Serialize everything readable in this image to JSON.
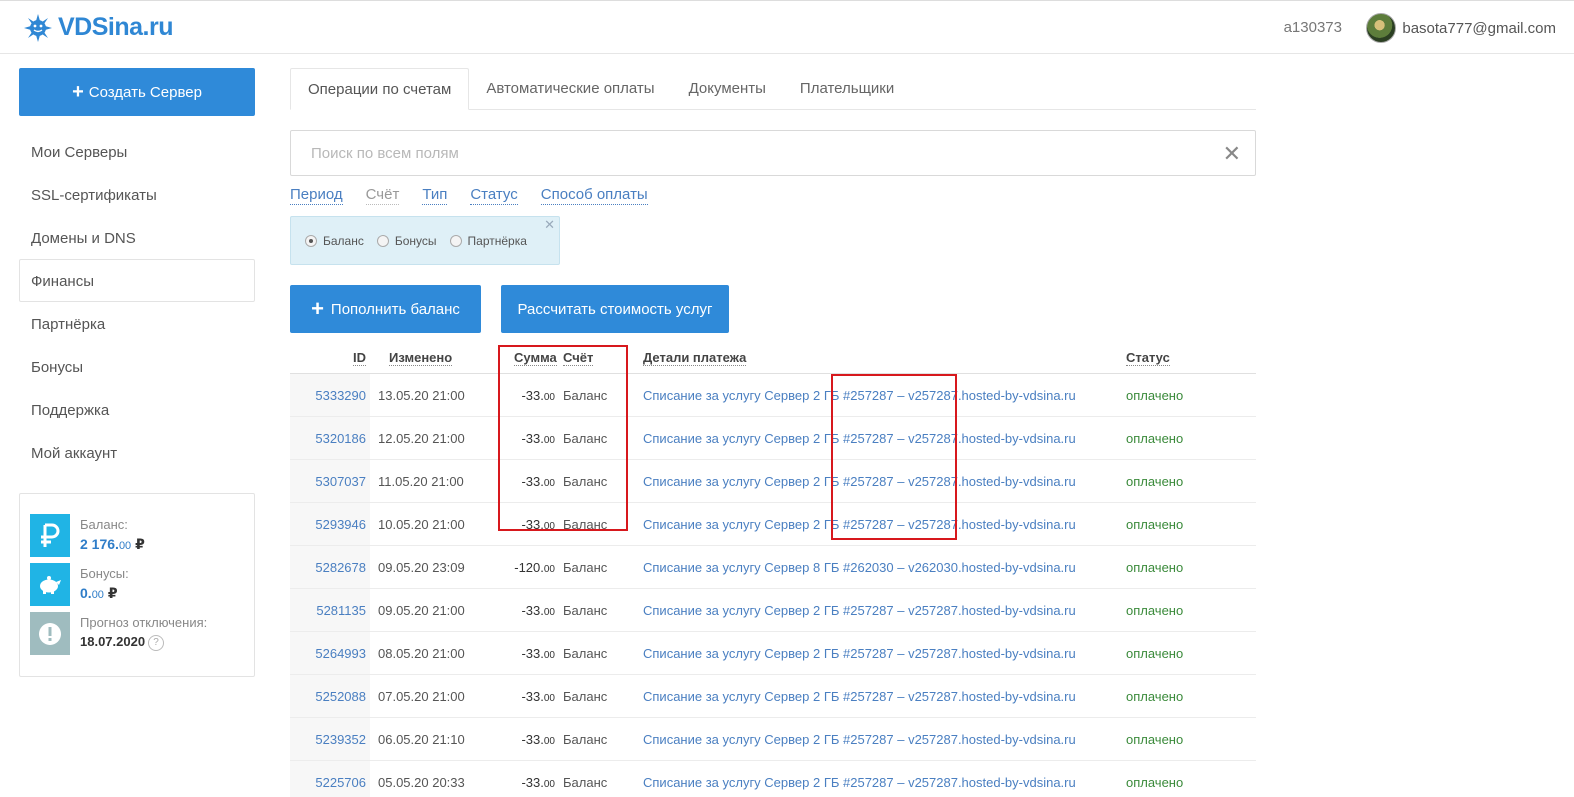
{
  "header": {
    "logo_text": "VDSina.ru",
    "account_id": "a130373",
    "user_email": "basota777@gmail.com"
  },
  "sidebar": {
    "create_button": "Создать Сервер",
    "items": [
      {
        "label": "Мои Серверы"
      },
      {
        "label": "SSL-сертификаты"
      },
      {
        "label": "Домены и DNS"
      },
      {
        "label": "Финансы"
      },
      {
        "label": "Партнёрка"
      },
      {
        "label": "Бонусы"
      },
      {
        "label": "Поддержка"
      },
      {
        "label": "Мой аккаунт"
      }
    ],
    "balance": {
      "balance_label": "Баланс:",
      "balance_int": "2 176.",
      "balance_frac": "00",
      "currency": "₽",
      "bonus_label": "Бонусы:",
      "bonus_int": "0.",
      "bonus_frac": "00",
      "forecast_label": "Прогноз отключения:",
      "forecast_date": "18.07.2020",
      "help": "?"
    }
  },
  "tabs": [
    {
      "label": "Операции по счетам",
      "active": true
    },
    {
      "label": "Автоматические оплаты"
    },
    {
      "label": "Документы"
    },
    {
      "label": "Плательщики"
    }
  ],
  "search": {
    "placeholder": "Поиск по всем полям",
    "value": ""
  },
  "filters": [
    {
      "label": "Период"
    },
    {
      "label": "Счёт"
    },
    {
      "label": "Тип"
    },
    {
      "label": "Статус"
    },
    {
      "label": "Способ оплаты"
    }
  ],
  "account_filter": {
    "options": [
      {
        "label": "Баланс",
        "checked": true
      },
      {
        "label": "Бонусы",
        "checked": false
      },
      {
        "label": "Партнёрка",
        "checked": false
      }
    ]
  },
  "actions": {
    "topup": "Пополнить баланс",
    "calc": "Рассчитать стоимость услуг"
  },
  "table": {
    "columns": {
      "id": "ID",
      "changed": "Изменено",
      "amount": "Сумма",
      "account": "Счёт",
      "details": "Детали платежа",
      "status": "Статус"
    },
    "rows": [
      {
        "id": "5333290",
        "changed": "13.05.20 21:00",
        "amount_int": "-33.",
        "amount_frac": "00",
        "account": "Баланс",
        "details": "Списание за услугу Сервер 2 ГБ #257287 – v257287.hosted-by-vdsina.ru",
        "status": "оплачено"
      },
      {
        "id": "5320186",
        "changed": "12.05.20 21:00",
        "amount_int": "-33.",
        "amount_frac": "00",
        "account": "Баланс",
        "details": "Списание за услугу Сервер 2 ГБ #257287 – v257287.hosted-by-vdsina.ru",
        "status": "оплачено"
      },
      {
        "id": "5307037",
        "changed": "11.05.20 21:00",
        "amount_int": "-33.",
        "amount_frac": "00",
        "account": "Баланс",
        "details": "Списание за услугу Сервер 2 ГБ #257287 – v257287.hosted-by-vdsina.ru",
        "status": "оплачено"
      },
      {
        "id": "5293946",
        "changed": "10.05.20 21:00",
        "amount_int": "-33.",
        "amount_frac": "00",
        "account": "Баланс",
        "details": "Списание за услугу Сервер 2 ГБ #257287 – v257287.hosted-by-vdsina.ru",
        "status": "оплачено"
      },
      {
        "id": "5282678",
        "changed": "09.05.20 23:09",
        "amount_int": "-120.",
        "amount_frac": "00",
        "account": "Баланс",
        "details": "Списание за услугу Сервер 8 ГБ #262030 – v262030.hosted-by-vdsina.ru",
        "status": "оплачено"
      },
      {
        "id": "5281135",
        "changed": "09.05.20 21:00",
        "amount_int": "-33.",
        "amount_frac": "00",
        "account": "Баланс",
        "details": "Списание за услугу Сервер 2 ГБ #257287 – v257287.hosted-by-vdsina.ru",
        "status": "оплачено"
      },
      {
        "id": "5264993",
        "changed": "08.05.20 21:00",
        "amount_int": "-33.",
        "amount_frac": "00",
        "account": "Баланс",
        "details": "Списание за услугу Сервер 2 ГБ #257287 – v257287.hosted-by-vdsina.ru",
        "status": "оплачено"
      },
      {
        "id": "5252088",
        "changed": "07.05.20 21:00",
        "amount_int": "-33.",
        "amount_frac": "00",
        "account": "Баланс",
        "details": "Списание за услугу Сервер 2 ГБ #257287 – v257287.hosted-by-vdsina.ru",
        "status": "оплачено"
      },
      {
        "id": "5239352",
        "changed": "06.05.20 21:10",
        "amount_int": "-33.",
        "amount_frac": "00",
        "account": "Баланс",
        "details": "Списание за услугу Сервер 2 ГБ #257287 – v257287.hosted-by-vdsina.ru",
        "status": "оплачено"
      },
      {
        "id": "5225706",
        "changed": "05.05.20 20:33",
        "amount_int": "-33.",
        "amount_frac": "00",
        "account": "Баланс",
        "details": "Списание за услугу Сервер 2 ГБ #257287 – v257287.hosted-by-vdsina.ru",
        "status": "оплачено"
      }
    ]
  },
  "colors": {
    "accent": "#2f8ad9",
    "link": "#4a7fc1",
    "paid": "#3a8a3a",
    "highlight": "#d7181d"
  }
}
